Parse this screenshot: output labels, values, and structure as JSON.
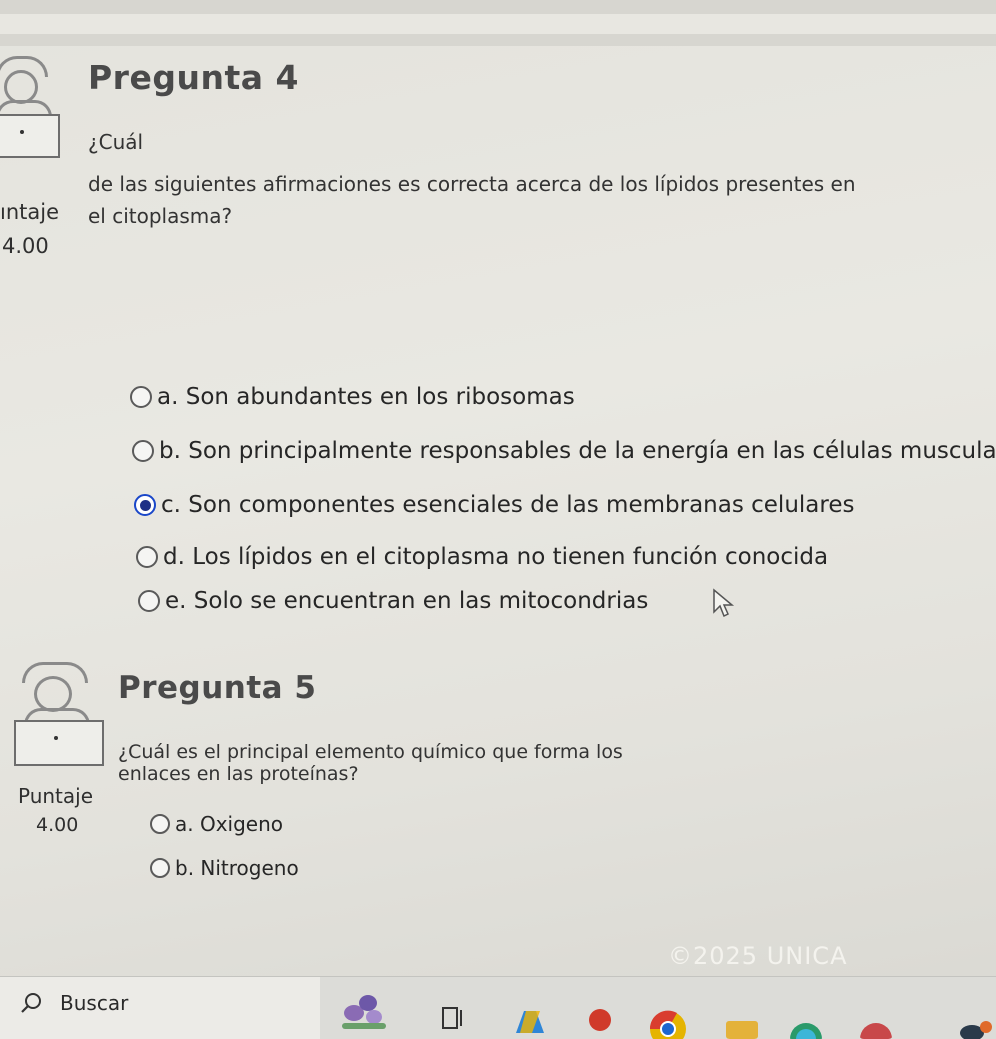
{
  "q4": {
    "title": "Pregunta 4",
    "text_line1": "¿Cuál",
    "text_line2": "de las siguientes afirmaciones es correcta acerca de los lípidos presentes en",
    "text_line3": "el citoplasma?",
    "score_label": "ıntaje",
    "score_value": "4.00",
    "options": [
      {
        "label": "a. Son abundantes en los ribosomas",
        "checked": false
      },
      {
        "label": "b. Son principalmente responsables de la energía en las células musculare",
        "checked": false
      },
      {
        "label": "c. Son componentes esenciales de las membranas celulares",
        "checked": true
      },
      {
        "label": "d. Los lípidos en el citoplasma no tienen función conocida",
        "checked": false
      },
      {
        "label": "e. Solo se encuentran en las mitocondrias",
        "checked": false
      }
    ]
  },
  "q5": {
    "title": "Pregunta 5",
    "text_line1": "¿Cuál es el principal elemento químico que forma los",
    "text_line2": "enlaces en las proteínas?",
    "score_label": "Puntaje",
    "score_value": "4.00",
    "options": [
      {
        "label": "a. Oxigeno",
        "checked": false
      },
      {
        "label": "b. Nitrogeno",
        "checked": false
      }
    ]
  },
  "footer": {
    "watermark": "©2025 UNICA"
  },
  "taskbar": {
    "search_placeholder": "Buscar",
    "icons": [
      "widgets-icon",
      "task-view-icon",
      "copilot-icon",
      "app-icon",
      "chrome-icon",
      "app-icon",
      "edge-icon",
      "edge-icon",
      "weather-icon"
    ]
  },
  "colors": {
    "accent": "#1d2f86",
    "radio_border": "#5a5a5a",
    "title": "#4a4a4a"
  }
}
